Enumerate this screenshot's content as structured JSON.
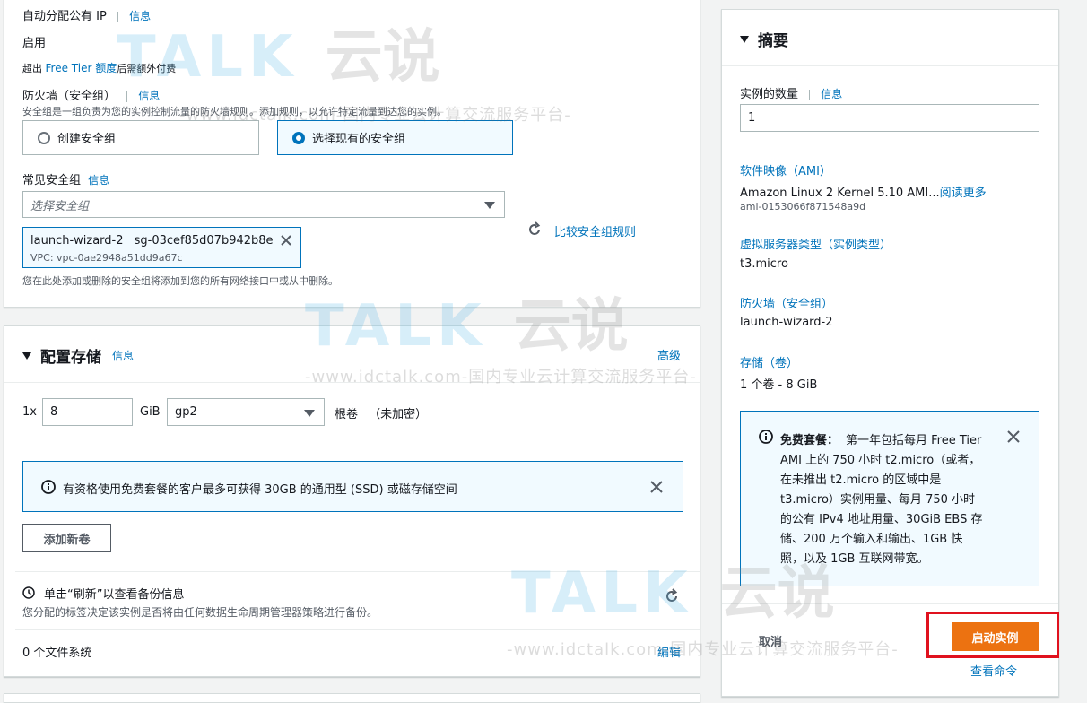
{
  "left": {
    "public_ip_label": "自动分配公有 IP",
    "public_ip_info": "信息",
    "public_ip_value": "启用",
    "free_tier_prefix": "超出",
    "free_tier_link": "Free Tier 额度",
    "free_tier_suffix": "后需额外付费",
    "firewall_label": "防火墙（安全组）",
    "firewall_info": "信息",
    "firewall_desc": "安全组是一组负责为您的实例控制流量的防火墙规则。添加规则，以允许特定流量到达您的实例。",
    "radio_create": "创建安全组",
    "radio_existing": "选择现有的安全组",
    "common_sg_label": "常见安全组",
    "common_sg_info": "信息",
    "sg_select_placeholder": "选择安全组",
    "sg_token_name": "launch-wizard-2",
    "sg_token_id": "sg-03cef85d07b942b8e",
    "sg_token_vpc": "VPC: vpc-0ae2948a51dd9a67c",
    "compare_rules": "比较安全组规则",
    "sg_note": "您在此处添加或删除的安全组将添加到您的所有网络接口中或从中删除。"
  },
  "storage": {
    "title": "配置存储",
    "info": "信息",
    "advanced": "高级",
    "count_prefix": "1x",
    "size_value": "8",
    "unit": "GiB",
    "volume_type": "gp2",
    "root_volume": "根卷",
    "encryption": "（未加密）",
    "free_tier_notice": "有资格使用免费套餐的客户最多可获得 30GB 的通用型 (SSD) 或磁存储空间",
    "add_volume": "添加新卷",
    "refresh_title": "单击“刷新”以查看备份信息",
    "refresh_desc": "您分配的标签决定该实例是否将由任何数据生命周期管理器策略进行备份。",
    "filesystems": "0 个文件系统",
    "edit": "编辑"
  },
  "summary": {
    "title": "摘要",
    "instances_label": "实例的数量",
    "instances_info": "信息",
    "instances_value": "1",
    "ami_label": "软件映像（AMI）",
    "ami_value": "Amazon Linux 2 Kernel 5.10 AMI...",
    "ami_more": "阅读更多",
    "ami_id": "ami-0153066f871548a9d",
    "type_label": "虚拟服务器类型（实例类型）",
    "type_value": "t3.micro",
    "fw_label": "防火墙（安全组）",
    "fw_value": "launch-wizard-2",
    "storage_label": "存储（卷）",
    "storage_value": "1 个卷 - 8 GiB",
    "free_tier_bold": "免费套餐：",
    "free_tier_line1": "第一年包括每月 Free Tier",
    "free_tier_line2": "AMI 上的 750 小时 t2.micro（或者，",
    "free_tier_line3": "在未推出 t2.micro 的区域中是",
    "free_tier_line4": "t3.micro）实例用量、每月 750 小时",
    "free_tier_line5": "的公有 IPv4 地址用量、30GiB EBS 存",
    "free_tier_line6": "储、200 万个输入和输出、1GB 快",
    "free_tier_line7": "照，以及 1GB 互联网带宽。",
    "cancel": "取消",
    "launch": "启动实例",
    "view_commands": "查看命令"
  },
  "watermark": {
    "logo": "TALK",
    "cn": "云说",
    "line": "-www.idctalk.com-国内专业云计算交流服务平台-"
  },
  "colors": {
    "link": "#0073bb",
    "primary_button": "#ec7211",
    "highlight_border": "#e0111e"
  }
}
